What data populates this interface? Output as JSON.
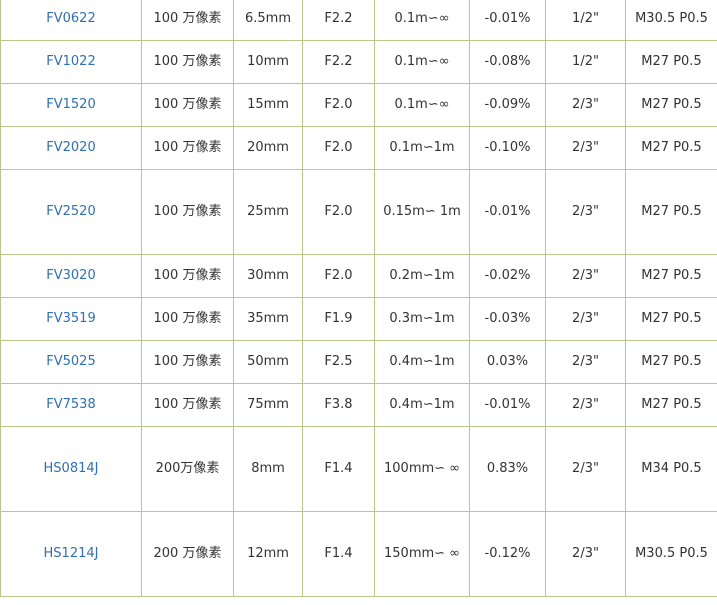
{
  "rows": [
    {
      "model": "FV0622",
      "resolution": "100 万像素",
      "focal": "6.5mm",
      "aperture": "F2.2",
      "distance": "0.1m∽∞",
      "distortion": "-0.01%",
      "sensor": "1/2\"",
      "mount": "M30.5 P0.5"
    },
    {
      "model": "FV1022",
      "resolution": "100 万像素",
      "focal": "10mm",
      "aperture": "F2.2",
      "distance": "0.1m∽∞",
      "distortion": "-0.08%",
      "sensor": "1/2\"",
      "mount": "M27 P0.5"
    },
    {
      "model": "FV1520",
      "resolution": "100 万像素",
      "focal": "15mm",
      "aperture": "F2.0",
      "distance": "0.1m∽∞",
      "distortion": "-0.09%",
      "sensor": "2/3\"",
      "mount": "M27 P0.5"
    },
    {
      "model": "FV2020",
      "resolution": "100 万像素",
      "focal": "20mm",
      "aperture": "F2.0",
      "distance": "0.1m∽1m",
      "distortion": "-0.10%",
      "sensor": "2/3\"",
      "mount": "M27 P0.5"
    },
    {
      "model": "FV2520",
      "resolution": "100 万像素",
      "focal": "25mm",
      "aperture": "F2.0",
      "distance": "0.15m∽ 1m",
      "distortion": "-0.01%",
      "sensor": "2/3\"",
      "mount": "M27 P0.5"
    },
    {
      "model": "FV3020",
      "resolution": "100 万像素",
      "focal": "30mm",
      "aperture": "F2.0",
      "distance": "0.2m∽1m",
      "distortion": "-0.02%",
      "sensor": "2/3\"",
      "mount": "M27 P0.5"
    },
    {
      "model": "FV3519",
      "resolution": "100 万像素",
      "focal": "35mm",
      "aperture": "F1.9",
      "distance": "0.3m∽1m",
      "distortion": "-0.03%",
      "sensor": "2/3\"",
      "mount": "M27 P0.5"
    },
    {
      "model": "FV5025",
      "resolution": "100 万像素",
      "focal": "50mm",
      "aperture": "F2.5",
      "distance": "0.4m∽1m",
      "distortion": "0.03%",
      "sensor": "2/3\"",
      "mount": "M27 P0.5"
    },
    {
      "model": "FV7538",
      "resolution": "100 万像素",
      "focal": "75mm",
      "aperture": "F3.8",
      "distance": "0.4m∽1m",
      "distortion": "-0.01%",
      "sensor": "2/3\"",
      "mount": "M27 P0.5"
    },
    {
      "model": "HS0814J",
      "resolution": "200万像素",
      "focal": "8mm",
      "aperture": "F1.4",
      "distance": "100mm∽ ∞",
      "distortion": "0.83%",
      "sensor": "2/3\"",
      "mount": "M34 P0.5"
    },
    {
      "model": "HS1214J",
      "resolution": "200 万像素",
      "focal": "12mm",
      "aperture": "F1.4",
      "distance": "150mm∽ ∞",
      "distortion": "-0.12%",
      "sensor": "2/3\"",
      "mount": "M30.5 P0.5"
    }
  ],
  "colors": {
    "link": "#2f6fb5",
    "border": "#b8c98a",
    "text": "#333333"
  }
}
